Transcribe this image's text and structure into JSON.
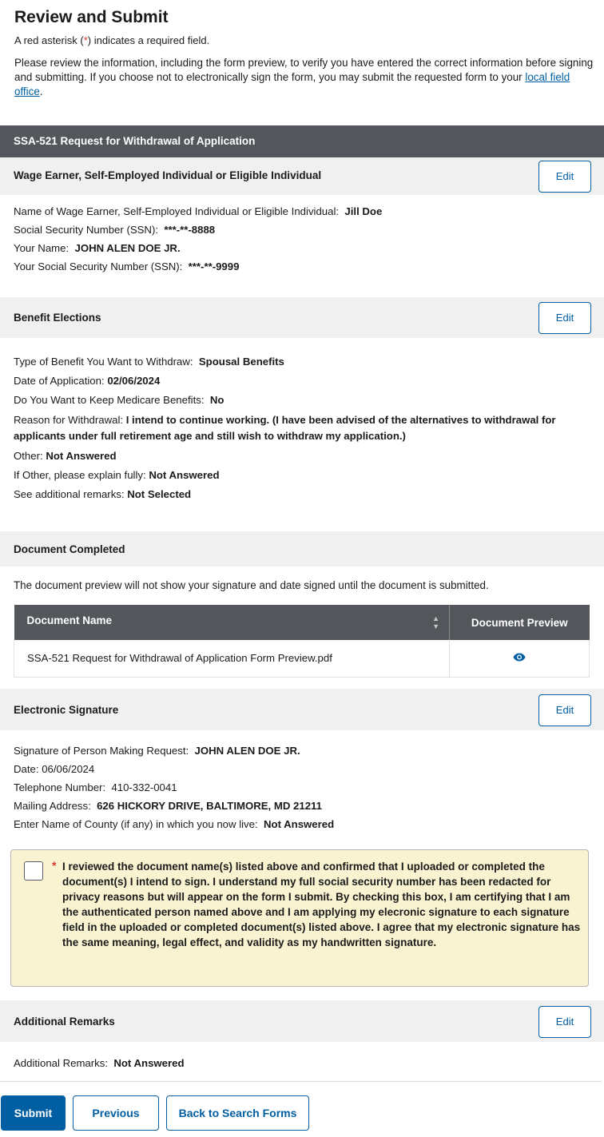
{
  "page": {
    "title": "Review and Submit",
    "required_note_prefix": "A red asterisk (",
    "required_note_ast": "*",
    "required_note_suffix": ") indicates a required field.",
    "intro": "Please review the information, including the form preview, to verify you have entered the correct information before signing and submitting. If you choose not to electronically sign the form, you may submit the requested form to your ",
    "intro_link": "local field office",
    "intro_end": "."
  },
  "form_header": "SSA-521 Request for Withdrawal of Application",
  "edit_label": "Edit",
  "wage_earner": {
    "heading": "Wage Earner, Self-Employed Individual or Eligible Individual",
    "rows": [
      {
        "label": "Name of Wage Earner, Self-Employed Individual or Eligible Individual:",
        "value": "Jill Doe"
      },
      {
        "label": "Social Security Number (SSN):",
        "value": "***-**-8888"
      },
      {
        "label": "Your Name:",
        "value": "JOHN ALEN DOE JR."
      },
      {
        "label": "Your Social Security Number (SSN):",
        "value": "***-**-9999"
      }
    ]
  },
  "benefit": {
    "heading": "Benefit Elections",
    "rows": [
      {
        "label": "Type of Benefit You Want to Withdraw:",
        "value": "Spousal Benefits"
      },
      {
        "label": "Date of Application:",
        "value": "02/06/2024"
      },
      {
        "label": "Do You Want to Keep Medicare Benefits:",
        "value": "No"
      },
      {
        "label": "Reason for Withdrawal:",
        "value": "I intend to continue working. (I have been advised of the alternatives to withdrawal for applicants under full retirement age and still wish to withdraw my application.)"
      },
      {
        "label": "Other:",
        "value": "Not Answered"
      },
      {
        "label": "If Other, please explain fully:",
        "value": "Not Answered"
      },
      {
        "label": "See additional remarks:",
        "value": "Not Selected"
      }
    ]
  },
  "document": {
    "heading": "Document Completed",
    "note": "The document preview will not show your signature and date signed until the document is submitted.",
    "col_name": "Document Name",
    "col_preview": "Document Preview",
    "rows": [
      {
        "name": "SSA-521 Request for Withdrawal of Application Form Preview.pdf",
        "preview_icon": "eye-icon"
      }
    ]
  },
  "signature": {
    "heading": "Electronic Signature",
    "rows": [
      {
        "label": "Signature of Person Making Request:",
        "value": "JOHN ALEN DOE JR."
      },
      {
        "label": "Date:",
        "value": "06/06/2024"
      },
      {
        "label": "Telephone Number:",
        "value": "410-332-0041"
      },
      {
        "label": "Mailing Address:",
        "value": "626 HICKORY DRIVE, BALTIMORE, MD 21211"
      },
      {
        "label": "Enter Name of County (if any) in which you now live:",
        "value": "Not Answered"
      }
    ]
  },
  "certification": {
    "asterisk": "*",
    "checked": false,
    "text": "I reviewed the document name(s) listed above and confirmed that I uploaded or completed the document(s) I intend to sign. I understand my full social security number has been redacted for privacy reasons but will appear on the form I submit. By checking this box, I am certifying that I am the authenticated person named above and I am applying my elecronic signature to each signature field in the uploaded or completed document(s) listed above. I agree that my electronic signature has the same meaning, legal effect, and validity as my handwritten signature."
  },
  "remarks": {
    "heading": "Additional Remarks",
    "label": "Additional Remarks:",
    "value": "Not Answered"
  },
  "buttons": {
    "submit": "Submit",
    "previous": "Previous",
    "back": "Back to Search Forms"
  },
  "colors": {
    "primary": "#005ea2",
    "header_bg": "#53565a",
    "section_bg": "#f0f0f0",
    "cert_bg": "#faf3d1",
    "required": "#d83933"
  }
}
